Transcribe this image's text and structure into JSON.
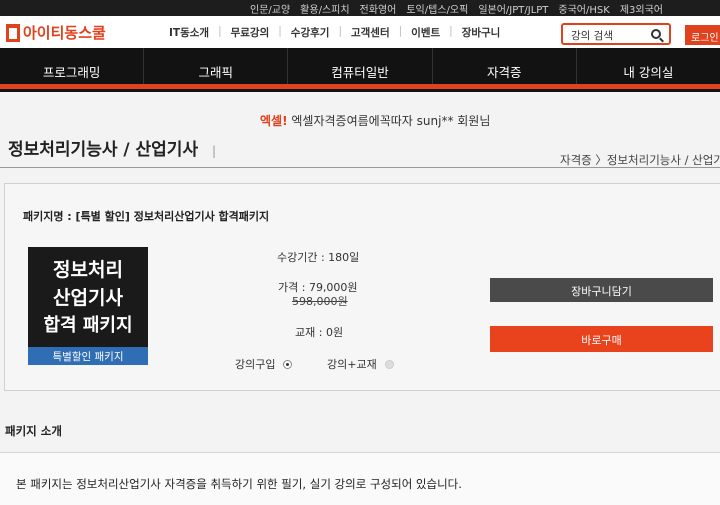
{
  "topbar": {
    "links": [
      "인문/교양",
      "활용/스피치",
      "전화영어",
      "토익/텝스/오픽",
      "일본어/JPT/JLPT",
      "중국어/HSK",
      "제3외국어"
    ]
  },
  "header": {
    "logo": "아이티동스쿨",
    "gnb": [
      "IT동소개",
      "무료강의",
      "수강후기",
      "고객센터",
      "이벤트",
      "장바구니"
    ],
    "search_placeholder": "강의 검색",
    "login_label": "로그인"
  },
  "nav": {
    "items": [
      "프로그래밍",
      "그래픽",
      "컴퓨터일반",
      "자격증",
      "내 강의실"
    ]
  },
  "welcome": {
    "tag": "엑셀!",
    "message": "엑셀자격증여름에꼭따자 sunj** 회원님"
  },
  "page": {
    "title": "정보처리기능사 / 산업기사",
    "title_sep": "|",
    "breadcrumb": "자격증 〉정보처리기능사 / 산업기사"
  },
  "package": {
    "name": "패키지명 : [특별 할인] 정보처리산업기사 합격패키지",
    "thumbnail": {
      "line1": "정보처리",
      "line2": "산업기사",
      "line3": "합격 패키지",
      "sub": "특별할인 패키지"
    },
    "period": "수강기간 : 180일",
    "price": "가격 : 79,000원",
    "original_price": "598,000원",
    "material": "교재 : 0원",
    "options": [
      {
        "label": "강의구입",
        "selected": true
      },
      {
        "label": "강의+교재",
        "selected": false
      }
    ],
    "cart_label": "장바구니담기",
    "buy_label": "바로구매"
  },
  "intro": {
    "title": "패키지 소개",
    "text": "본 패키지는 정보처리산업기사 자격증을 취득하기 위한 필기, 실기 강의로 구성되어 있습니다."
  },
  "colors": {
    "accent": "#e0421e",
    "nav_bg": "#121212",
    "cart_button": "#4a4a4a",
    "badge_blue": "#2f6db5"
  }
}
